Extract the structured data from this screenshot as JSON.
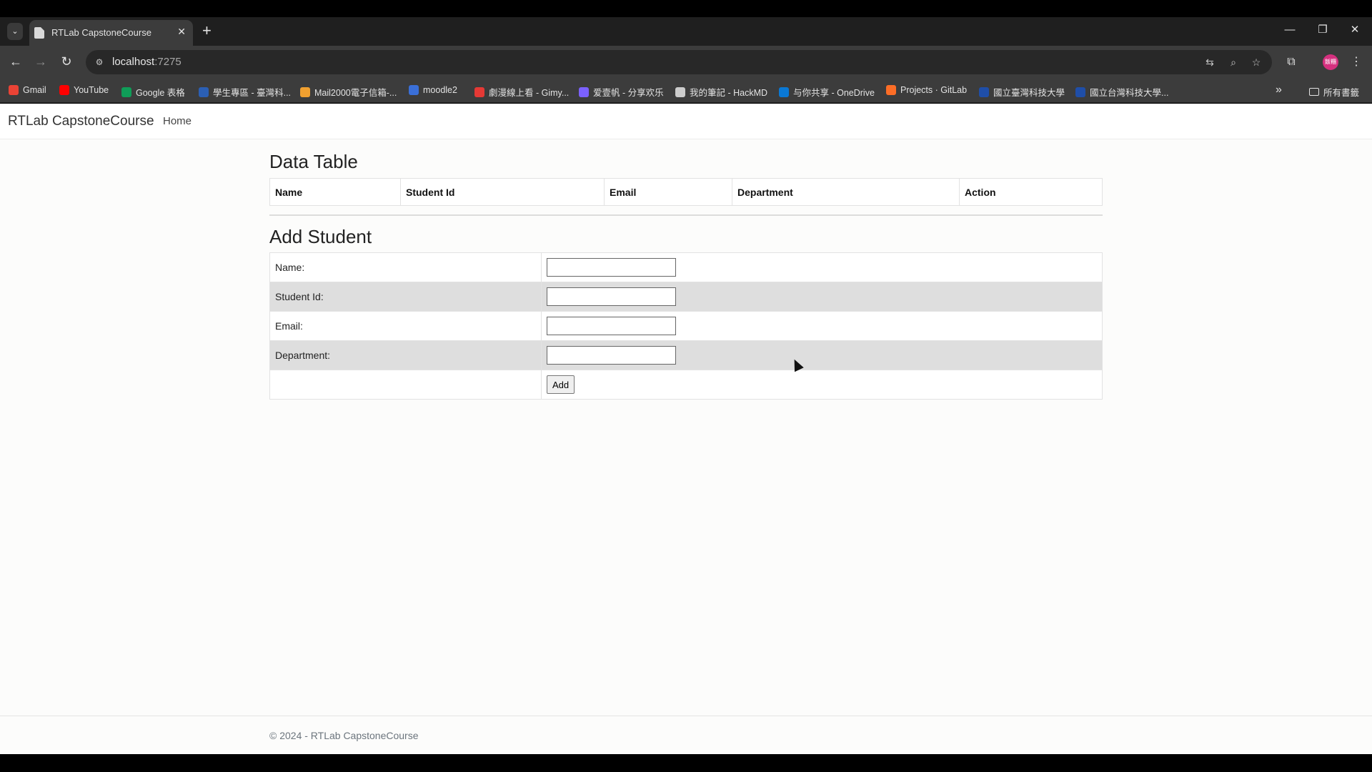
{
  "browser": {
    "tab_title": "RTLab CapstoneCourse",
    "url_host": "localhost",
    "url_port": ":7275",
    "tab_menu_icon": "chevron-down-icon",
    "new_tab_label": "+",
    "close_label": "✕",
    "bookmarks": [
      {
        "label": "Gmail",
        "color": "#ea4335"
      },
      {
        "label": "YouTube",
        "color": "#ff0000"
      },
      {
        "label": "Google 表格",
        "color": "#0f9d58"
      },
      {
        "label": "學生專區 - 臺灣科...",
        "color": "#2b5fb4"
      },
      {
        "label": "Mail2000電子信箱-...",
        "color": "#f0a030"
      },
      {
        "label": "moodle2",
        "color": "#3a6fd8"
      },
      {
        "label": "劇漫線上看 - Gimy...",
        "color": "#e53935"
      },
      {
        "label": "爱壹帆 - 分享欢乐",
        "color": "#7b61ff"
      },
      {
        "label": "我的筆記 - HackMD",
        "color": "#cccccc"
      },
      {
        "label": "与你共享 - OneDrive",
        "color": "#0a78d4"
      },
      {
        "label": "Projects · GitLab",
        "color": "#fc6d26"
      },
      {
        "label": "國立臺灣科技大學",
        "color": "#1f4ea8"
      },
      {
        "label": "國立台灣科技大學...",
        "color": "#1f4ea8"
      }
    ],
    "all_bookmarks_label": "所有書籤",
    "profile_label": "飯糰"
  },
  "app": {
    "brand": "RTLab CapstoneCourse",
    "nav_home": "Home"
  },
  "data_table": {
    "title": "Data Table",
    "columns": [
      "Name",
      "Student Id",
      "Email",
      "Department",
      "Action"
    ]
  },
  "add_student": {
    "title": "Add Student",
    "fields": [
      {
        "label": "Name:",
        "value": ""
      },
      {
        "label": "Student Id:",
        "value": ""
      },
      {
        "label": "Email:",
        "value": ""
      },
      {
        "label": "Department:",
        "value": ""
      }
    ],
    "submit_label": "Add"
  },
  "footer": {
    "text": "© 2024 - RTLab CapstoneCourse"
  }
}
